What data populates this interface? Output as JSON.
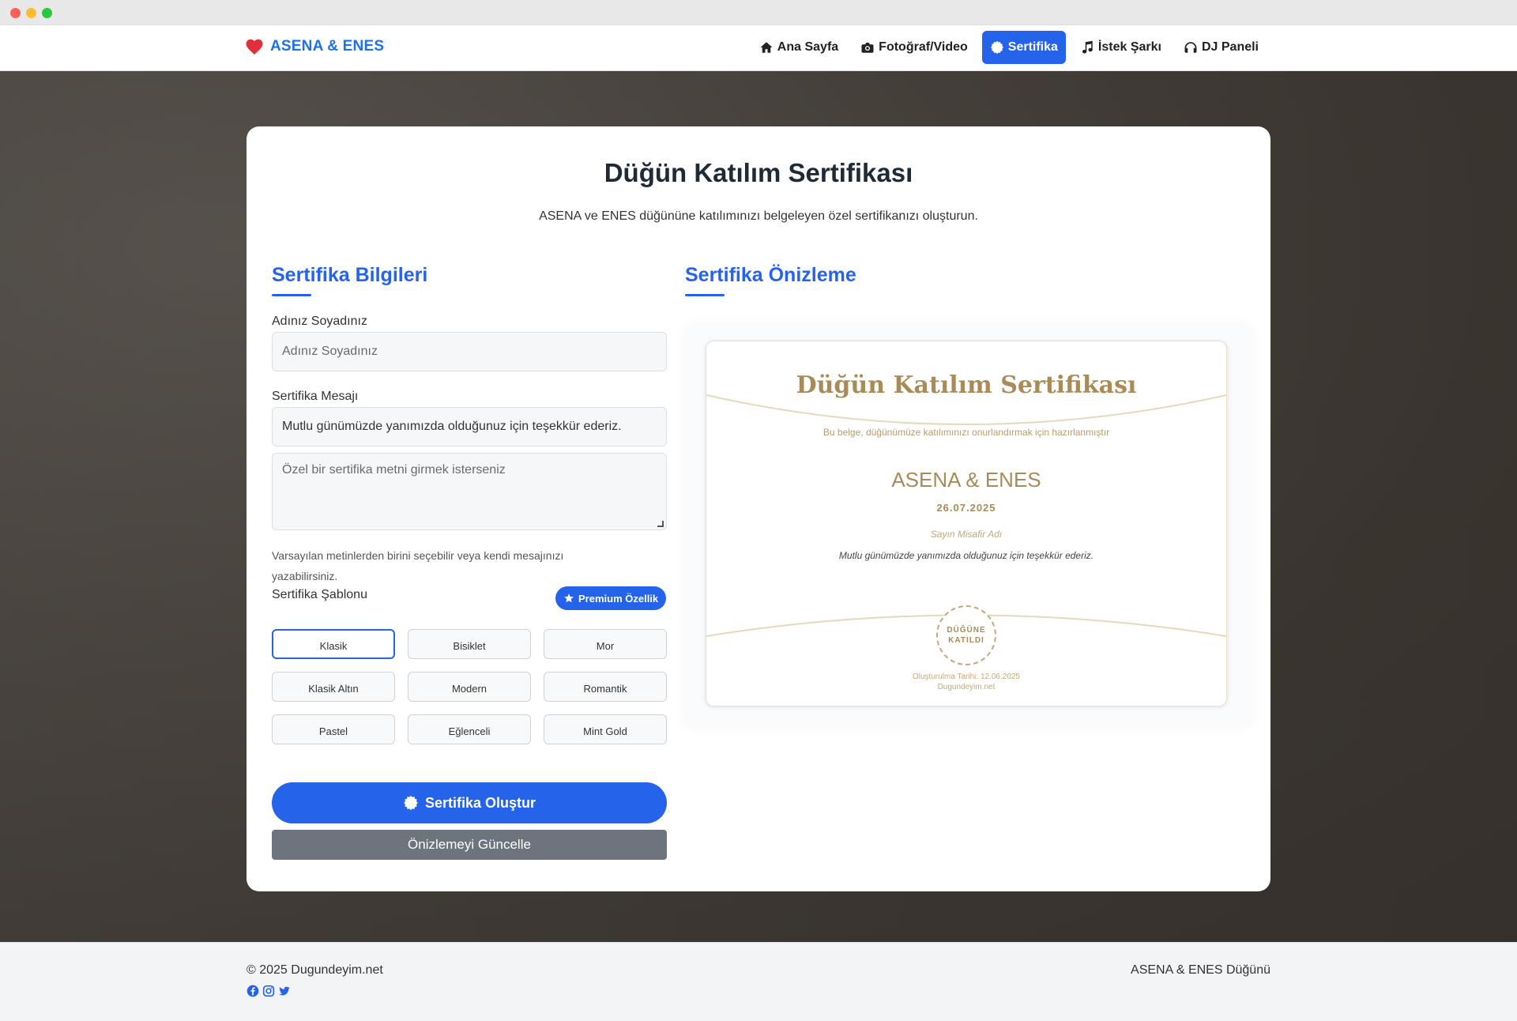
{
  "brand": {
    "name": "ASENA & ENES",
    "accent": "#1a73e8",
    "heart_color": "#e0313b"
  },
  "nav": {
    "items": [
      {
        "label": "Ana Sayfa",
        "icon": "home-icon"
      },
      {
        "label": "Fotoğraf/Video",
        "icon": "camera-icon"
      },
      {
        "label": "Sertifika",
        "icon": "certificate-icon",
        "active": true
      },
      {
        "label": "İstek Şarkı",
        "icon": "music-icon"
      },
      {
        "label": "DJ Paneli",
        "icon": "headphones-icon"
      }
    ],
    "active_color": "#2563eb"
  },
  "page": {
    "title": "Düğün Katılım Sertifikası",
    "subtitle": "ASENA ve ENES düğününe katılımınızı belgeleyen özel sertifikanızı oluşturun."
  },
  "form": {
    "section_title": "Sertifika Bilgileri",
    "name_label": "Adınız Soyadınız",
    "name_placeholder": "Adınız Soyadınız",
    "message_label": "Sertifika Mesajı",
    "message_value": "Mutlu günümüzde yanımızda olduğunuz için teşekkür ederiz.",
    "custom_text_placeholder": "Özel bir sertifika metni girmek isterseniz",
    "hint": "Varsayılan metinlerden birini seçebilir veya kendi mesajınızı yazabilirsiniz.",
    "template_label": "Sertifika Şablonu",
    "premium_badge": "Premium Özellik",
    "templates": [
      "Klasik",
      "Bisiklet",
      "Mor",
      "Klasik Altın",
      "Modern",
      "Romantik",
      "Pastel",
      "Eğlenceli",
      "Mint Gold"
    ],
    "selected_template": "Klasik",
    "create_button": "Sertifika Oluştur",
    "update_preview_button": "Önizlemeyi Güncelle"
  },
  "preview": {
    "section_title": "Sertifika Önizleme",
    "cert_title": "Düğün Katılım Sertifikası",
    "cert_subtitle": "Bu belge, düğünümüze katılımınızı onurlandırmak için hazırlanmıştır",
    "couple": "ASENA & ENES",
    "date": "26.07.2025",
    "guest_placeholder": "Sayın Misafir Adı",
    "message": "Mutlu günümüzde yanımızda olduğunuz için teşekkür ederiz.",
    "seal_line1": "DÜĞÜNE",
    "seal_line2": "KATILDI",
    "created_date": "Oluşturulma Tarihi: 12.06.2025",
    "site": "Dugundeyim.net",
    "gold_color": "#a98b58"
  },
  "footer": {
    "copyright": "© 2025 Dugundeyim.net",
    "right_text": "ASENA & ENES Düğünü",
    "social": [
      "facebook-icon",
      "instagram-icon",
      "twitter-icon"
    ],
    "social_color": "#2563eb"
  }
}
